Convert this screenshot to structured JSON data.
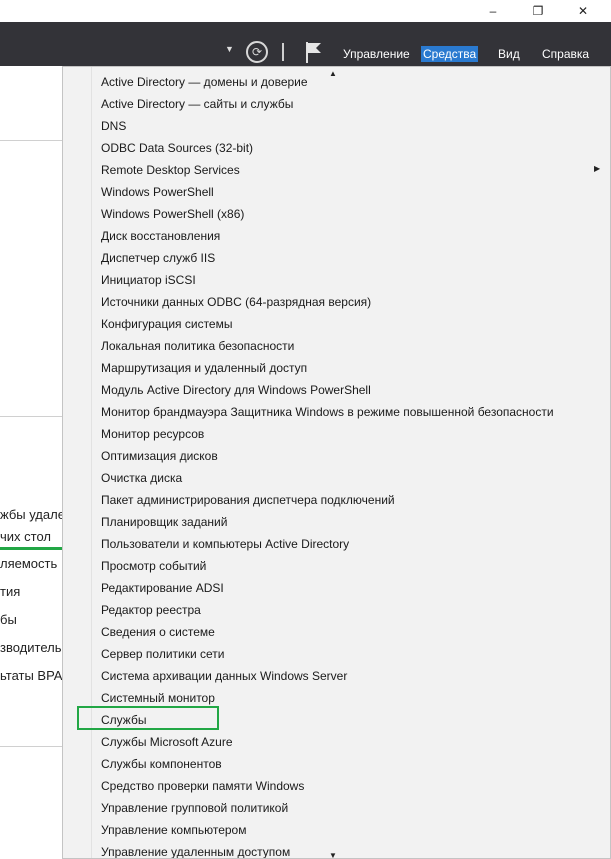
{
  "window": {
    "controls": {
      "minimize": "–",
      "restore": "❐",
      "close": "✕"
    }
  },
  "toolbar": {
    "dropdown_icon": "caret-down-icon",
    "refresh_icon": "refresh-icon",
    "flag_icon": "flag-icon",
    "menus": [
      "Управление",
      "Средства",
      "Вид",
      "Справка"
    ],
    "active_menu": "Средства",
    "accent": "#2a7ad0"
  },
  "left_pane": {
    "lines": [
      "жбы удале",
      "чих стол",
      "ляемость",
      "тия",
      "бы",
      "зводитель",
      "ьтаты BPA"
    ],
    "accent_line": "#22a745"
  },
  "tools_menu": {
    "partial_top_item": "Active Directory — домены и доверие",
    "items": [
      "Active Directory — сайты и службы",
      "DNS",
      "ODBC Data Sources (32-bit)",
      "Remote Desktop Services",
      "Windows PowerShell",
      "Windows PowerShell (x86)",
      "Диск восстановления",
      "Диспетчер служб IIS",
      "Инициатор iSCSI",
      "Источники данных ODBC (64-разрядная версия)",
      "Конфигурация системы",
      "Локальная политика безопасности",
      "Маршрутизация и удаленный доступ",
      "Модуль Active Directory для Windows PowerShell",
      "Монитор брандмауэра Защитника Windows в режиме повышенной безопасности",
      "Монитор ресурсов",
      "Оптимизация дисков",
      "Очистка диска",
      "Пакет администрирования диспетчера подключений",
      "Планировщик заданий",
      "Пользователи и компьютеры Active Directory",
      "Просмотр событий",
      "Редактирование ADSI",
      "Редактор реестра",
      "Сведения о системе",
      "Сервер политики сети",
      "Система архивации данных Windows Server",
      "Системный монитор",
      "Службы",
      "Службы Microsoft Azure",
      "Службы компонентов",
      "Средство проверки памяти Windows",
      "Управление групповой политикой",
      "Управление компьютером"
    ],
    "partial_bottom_item": "Управление удаленным доступом",
    "submenu_item": "Remote Desktop Services",
    "highlighted_item": "Службы",
    "highlight_color": "#22a745",
    "scroll_up_icon": "scroll-up-arrow-icon",
    "scroll_down_icon": "scroll-down-arrow-icon"
  }
}
